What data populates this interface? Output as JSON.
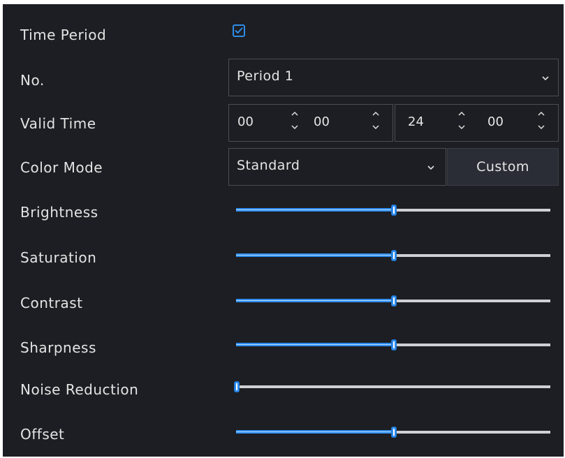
{
  "labels": {
    "time_period": "Time Period",
    "no": "No.",
    "valid_time": "Valid Time",
    "color_mode": "Color Mode",
    "brightness": "Brightness",
    "saturation": "Saturation",
    "contrast": "Contrast",
    "sharpness": "Sharpness",
    "noise_reduction": "Noise Reduction",
    "offset": "Offset"
  },
  "time_period_checked": true,
  "period_select": {
    "value": "Period 1"
  },
  "valid_time": {
    "start_hour": "00",
    "start_minute": "00",
    "end_hour": "24",
    "end_minute": "00"
  },
  "color_mode_select": {
    "value": "Standard"
  },
  "custom_button": "Custom",
  "sliders": {
    "brightness": 50,
    "saturation": 50,
    "contrast": 50,
    "sharpness": 50,
    "noise_reduction": 0,
    "offset": 50
  },
  "colors": {
    "background": "#1d1e23",
    "accent": "#2d8ef0",
    "track": "#cfd0d4",
    "border": "#4b4d55"
  }
}
